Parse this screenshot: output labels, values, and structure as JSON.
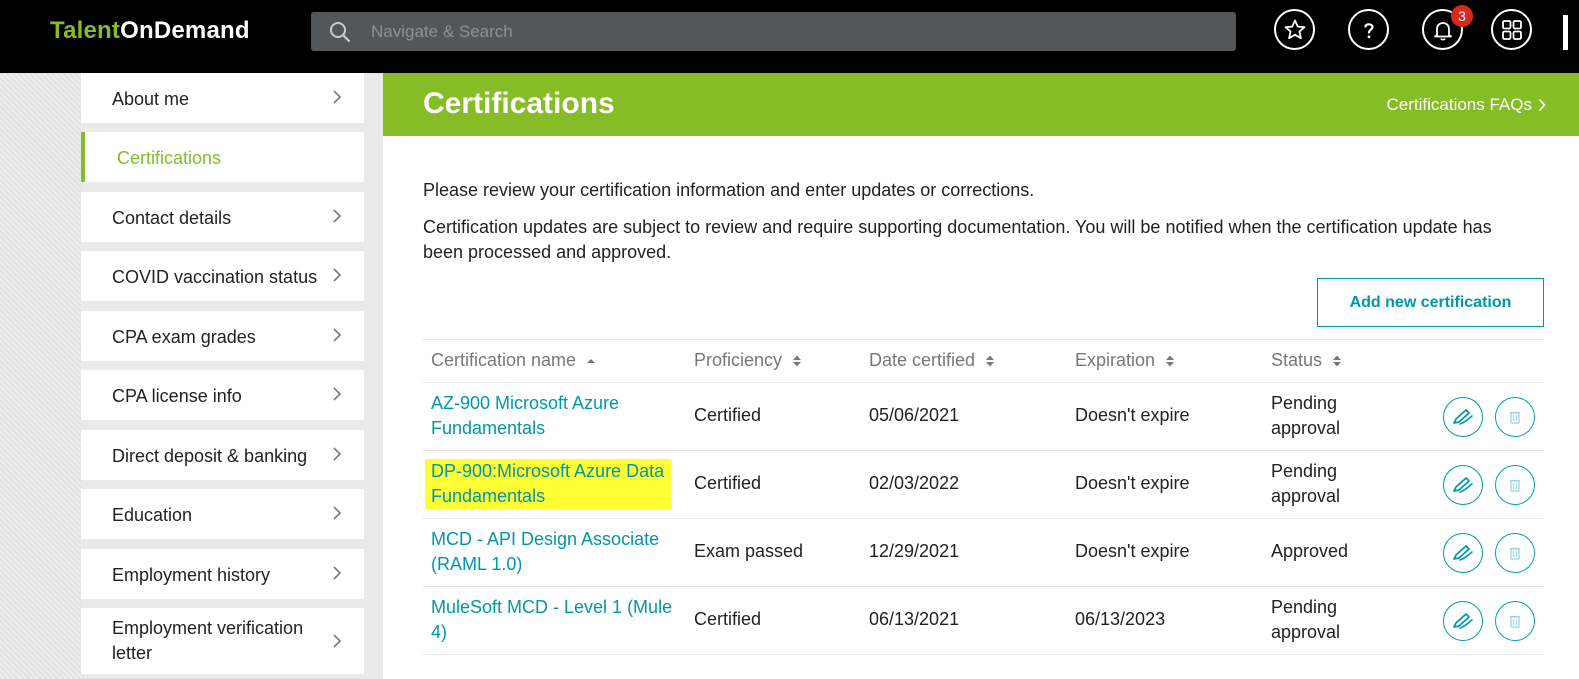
{
  "topbar": {
    "logo_part1": "Talent",
    "logo_part2": "OnDemand",
    "search_placeholder": "Navigate & Search",
    "notifications_count": "3",
    "icons": [
      "search-icon",
      "star-icon",
      "help-icon",
      "bell-icon",
      "apps-grid-icon"
    ]
  },
  "sidebar": {
    "items": [
      {
        "label": "About me"
      },
      {
        "label": "Certifications",
        "active": true
      },
      {
        "label": "Contact details"
      },
      {
        "label": "COVID vaccination status"
      },
      {
        "label": "CPA exam grades"
      },
      {
        "label": "CPA license info"
      },
      {
        "label": "Direct deposit & banking"
      },
      {
        "label": "Education"
      },
      {
        "label": "Employment history"
      },
      {
        "label": "Employment verification letter"
      }
    ]
  },
  "main": {
    "title": "Certifications",
    "faq_link": "Certifications FAQs",
    "intro1": "Please review your certification information and enter updates or corrections.",
    "intro2": "Certification updates are subject to review and require supporting documentation. You will be notified when the certification update has been processed and approved.",
    "add_button": "Add new certification"
  },
  "table": {
    "headers": [
      "Certification name",
      "Proficiency",
      "Date certified",
      "Expiration",
      "Status"
    ],
    "rows": [
      {
        "name": "AZ-900 Microsoft Azure Fundamentals",
        "proficiency": "Certified",
        "date": "05/06/2021",
        "expiration": "Doesn't expire",
        "status": "Pending approval",
        "highlighted": false
      },
      {
        "name": "DP-900:Microsoft Azure Data Fundamentals",
        "proficiency": "Certified",
        "date": "02/03/2022",
        "expiration": "Doesn't expire",
        "status": "Pending approval",
        "highlighted": true
      },
      {
        "name": "MCD - API Design Associate (RAML 1.0)",
        "proficiency": "Exam passed",
        "date": "12/29/2021",
        "expiration": "Doesn't expire",
        "status": "Approved",
        "highlighted": false
      },
      {
        "name": "MuleSoft MCD - Level 1 (Mule 4)",
        "proficiency": "Certified",
        "date": "06/13/2021",
        "expiration": "06/13/2023",
        "status": "Pending approval",
        "highlighted": false
      }
    ]
  },
  "colors": {
    "brand_green": "#86bc25",
    "link_teal": "#0097a9",
    "highlight": "#ffff33",
    "badge_red": "#da291c"
  }
}
